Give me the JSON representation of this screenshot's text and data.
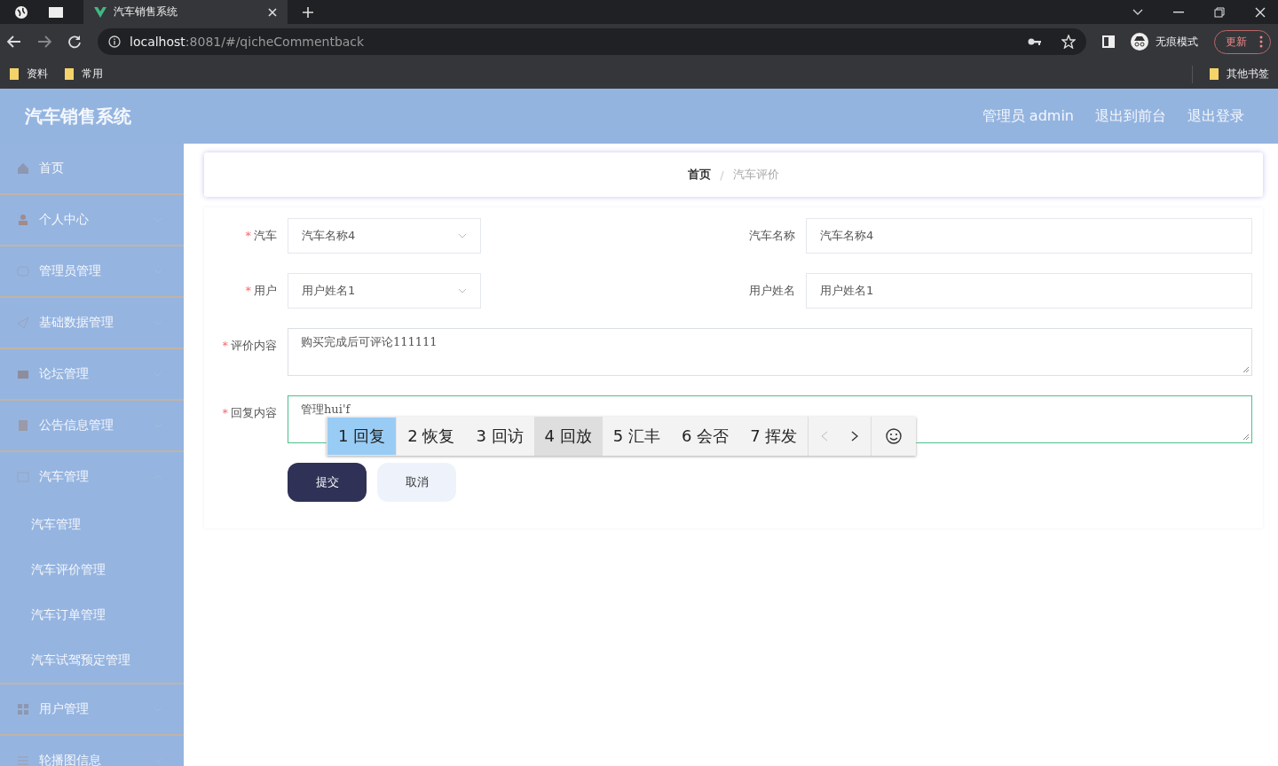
{
  "browser": {
    "tabs": [
      {
        "title": "汽车销售系统",
        "selected": true
      }
    ],
    "address": {
      "host": "localhost",
      "path": ":8081/#/qicheCommentback"
    },
    "profile": "无痕模式",
    "update": "更新",
    "bookmarks": [
      "资料",
      "常用"
    ],
    "other_bookmarks": "其他书签"
  },
  "header": {
    "title": "汽车销售系统",
    "links": [
      "管理员 admin",
      "退出到前台",
      "退出登录"
    ]
  },
  "sidebar": {
    "items": [
      {
        "label": "首页"
      },
      {
        "label": "个人中心",
        "expanded": false
      },
      {
        "label": "管理员管理",
        "expanded": false
      },
      {
        "label": "基础数据管理",
        "expanded": false
      },
      {
        "label": "论坛管理",
        "expanded": false
      },
      {
        "label": "公告信息管理",
        "expanded": false
      },
      {
        "label": "汽车管理",
        "expanded": true,
        "children": [
          {
            "label": "汽车管理"
          },
          {
            "label": "汽车评价管理"
          },
          {
            "label": "汽车订单管理"
          },
          {
            "label": "汽车试驾预定管理"
          }
        ]
      },
      {
        "label": "用户管理",
        "expanded": false
      },
      {
        "label": "轮播图信息",
        "expanded": false
      }
    ]
  },
  "breadcrumb": {
    "separator": "/",
    "items": [
      {
        "label": "首页",
        "current": false
      },
      {
        "label": "汽车评价",
        "current": true
      }
    ]
  },
  "form": {
    "required_mark": "*",
    "rows": [
      [
        {
          "kind": "select",
          "label": "汽车",
          "required": true,
          "value": "汽车名称4"
        },
        {
          "kind": "input",
          "label": "汽车名称",
          "required": false,
          "value": "汽车名称4"
        }
      ],
      [
        {
          "kind": "select",
          "label": "用户",
          "required": true,
          "value": "用户姓名1"
        },
        {
          "kind": "input",
          "label": "用户姓名",
          "required": false,
          "value": "用户姓名1"
        }
      ],
      [
        {
          "kind": "textarea",
          "label": "评价内容",
          "required": true,
          "value": "购买完成后可评论111111",
          "focused": false
        }
      ],
      [
        {
          "kind": "textarea",
          "label": "回复内容",
          "required": true,
          "value": "管理hui'f",
          "focused": true
        }
      ]
    ],
    "buttons": [
      {
        "label": "提交",
        "kind": "primary"
      },
      {
        "label": "取消",
        "kind": "secondary"
      }
    ]
  },
  "ime": {
    "candidates": [
      {
        "number": "1",
        "text": "回复",
        "selected": true,
        "hovered": false
      },
      {
        "number": "2",
        "text": "恢复",
        "selected": false,
        "hovered": false
      },
      {
        "number": "3",
        "text": "回访",
        "selected": false,
        "hovered": false
      },
      {
        "number": "4",
        "text": "回放",
        "selected": false,
        "hovered": true
      },
      {
        "number": "5",
        "text": "汇丰",
        "selected": false,
        "hovered": false
      },
      {
        "number": "6",
        "text": "会否",
        "selected": false,
        "hovered": false
      },
      {
        "number": "7",
        "text": "挥发",
        "selected": false,
        "hovered": false
      }
    ]
  }
}
